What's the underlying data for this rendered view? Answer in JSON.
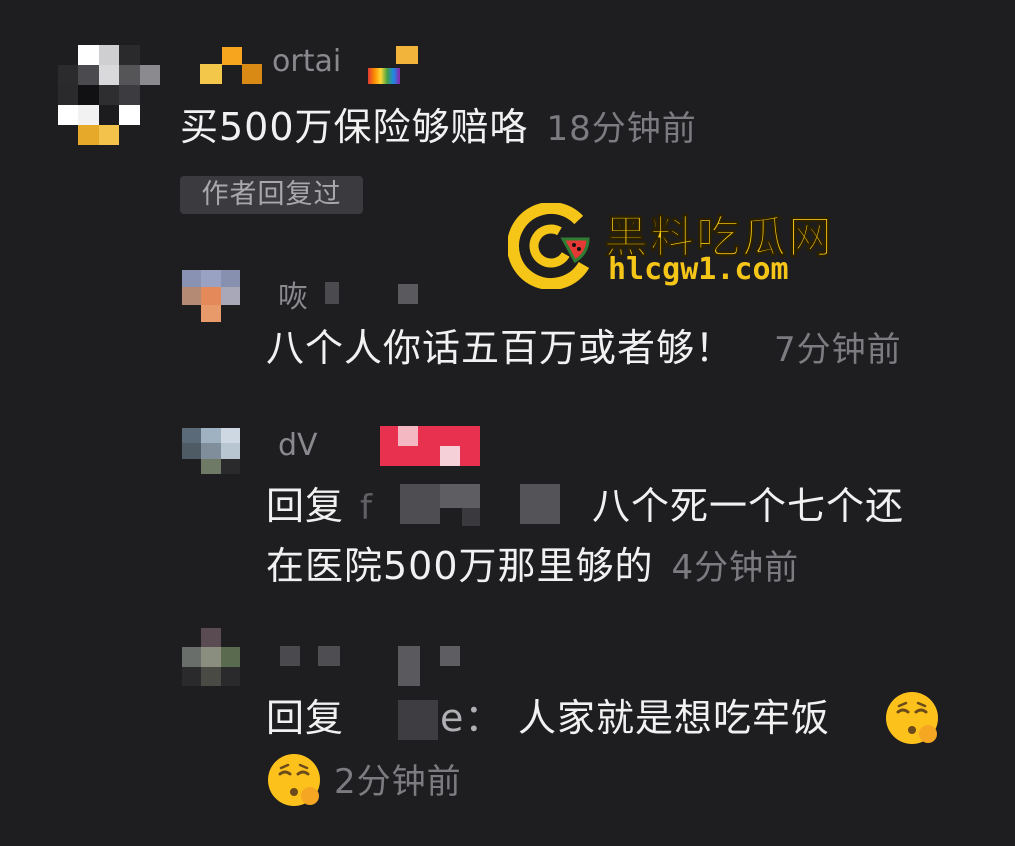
{
  "comments": {
    "top": {
      "username": "ortai",
      "text": "买500万保险够赔咯",
      "time": "18分钟前",
      "author_badge": "作者回复过"
    },
    "reply1": {
      "username": "咴",
      "text": "八个人你话五百万或者够！",
      "time": "7分钟前"
    },
    "reply2": {
      "username": "dV",
      "reply_prefix": "回复",
      "mention_mosaic_char": "f",
      "text_line1": "八个死一个七个还",
      "text_line2": "在医院500万那里够的",
      "time": "4分钟前"
    },
    "reply3": {
      "reply_prefix": "回复",
      "mention_tail": "e：",
      "text": "人家就是想吃牢饭",
      "emoji": "shushing-face-emoji",
      "time": "2分钟前"
    }
  },
  "watermark": {
    "title": "黑料吃瓜网",
    "url": "hlcgw1.com",
    "logo_icon": "watermelon-c-logo-icon",
    "color": "#f5c518"
  },
  "colors": {
    "background": "#1e1e21",
    "text": "#f1f1f1",
    "muted": "#7b7b80",
    "badge_bg": "#3a3a3f"
  }
}
